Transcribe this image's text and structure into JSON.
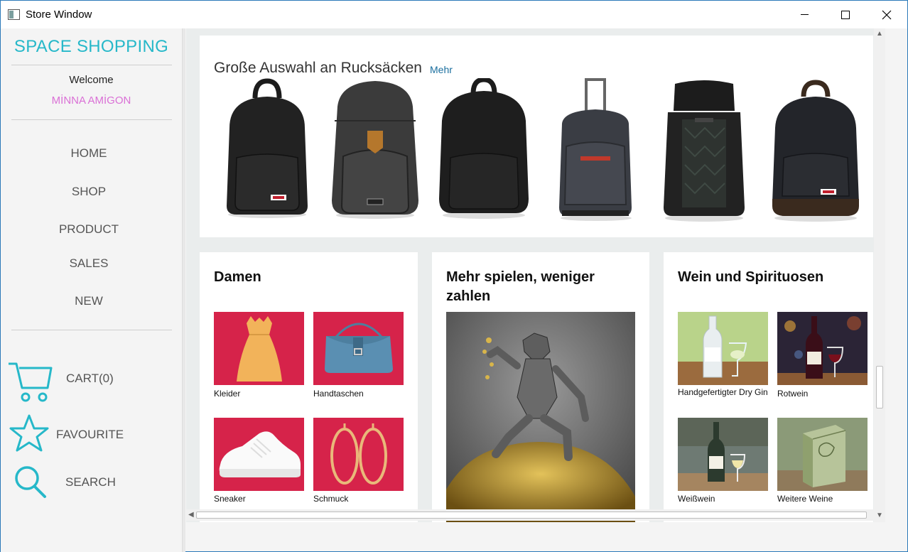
{
  "window": {
    "title": "Store Window",
    "controls": [
      "minimize",
      "maximize",
      "close"
    ]
  },
  "sidebar": {
    "brand": "SPACE SHOPPING",
    "welcome": "Welcome",
    "username": "MİNNA AMİGON",
    "nav": [
      {
        "label": "HOME"
      },
      {
        "label": "SHOP"
      },
      {
        "label": "PRODUCT"
      },
      {
        "label": "SALES"
      },
      {
        "label": "NEW"
      }
    ],
    "cart_label": "CART(0)",
    "favourite_label": "FAVOURITE",
    "search_label": "SEARCH",
    "accent_color": "#26b8c9",
    "username_color": "#da70d6"
  },
  "hero": {
    "title": "Große Auswahl an Rucksäcken",
    "more": "Mehr",
    "items": [
      "backpack-black-eastpak",
      "backpack-grey-leather-patch",
      "backpack-black-plain",
      "rolling-backpack-grey",
      "rolltop-backpack-black",
      "backpack-black-eastpak-brown"
    ]
  },
  "cards": {
    "damen": {
      "title": "Damen",
      "tiles": [
        {
          "label": "Kleider",
          "icon": "dress-image"
        },
        {
          "label": "Handtaschen",
          "icon": "handbag-image"
        },
        {
          "label": "Sneaker",
          "icon": "sneaker-image"
        },
        {
          "label": "Schmuck",
          "icon": "earrings-image"
        }
      ],
      "tile_bg": "#d6234a"
    },
    "spielen": {
      "title": "Mehr spielen, weniger zahlen",
      "image": "knight-on-gold-coins-image"
    },
    "wein": {
      "title": "Wein und Spirituosen",
      "tiles": [
        {
          "label": "Handgefertigter Dry Gin",
          "icon": "gin-bottle-image"
        },
        {
          "label": "Rotwein",
          "icon": "red-wine-image"
        },
        {
          "label": "Weißwein",
          "icon": "white-wine-image"
        },
        {
          "label": "Weitere Weine",
          "icon": "wine-box-image"
        }
      ]
    }
  }
}
